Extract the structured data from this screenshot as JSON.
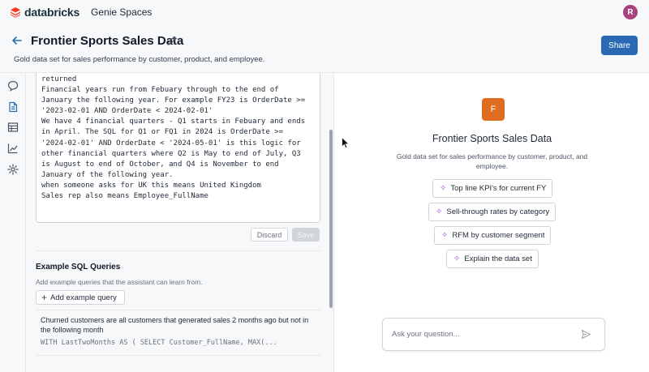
{
  "topbar": {
    "brand": "databricks",
    "product": "Genie Spaces",
    "avatar_initial": "R",
    "avatar_color": "#a5427f"
  },
  "header": {
    "title": "Frontier Sports Sales Data",
    "subtitle": "Gold data set for sales performance by customer, product, and employee.",
    "share_label": "Share",
    "accent_color": "#2a6ab5"
  },
  "rail": {
    "icons": [
      "chat-icon",
      "document-icon",
      "table-icon",
      "chart-icon",
      "gear-icon"
    ],
    "active": "document-icon"
  },
  "instructions": {
    "lines": [
      "returned",
      "Financial years run from Febuary through to the end of",
      "January the following year. For example FY23 is OrderDate >=",
      "'2023-02-01 AND OrderDate < 2024-02-01'",
      "We have 4 financial quarters - Q1 starts in Febuary and ends",
      "in April. The SQL for Q1 or FQ1 in 2024 is OrderDate >=",
      "'2024-02-01' AND OrderDate < '2024-05-01' is this logic for",
      "other financial quarters where Q2 is May to end of July, Q3",
      "is August to end of October, and Q4 is November to end",
      "January of the following year.",
      "when someone asks for UK this means United Kingdom",
      "Sales rep also means Employee_FullName"
    ],
    "discard_label": "Discard",
    "save_label": "Save"
  },
  "example_queries": {
    "title": "Example SQL Queries",
    "description": "Add example queries that the assistant can learn from.",
    "add_label": "Add example query",
    "items": [
      {
        "question": "Churned customers are all customers that generated sales 2 months ago but not in the following month",
        "sql": "WITH LastTwoMonths AS ( SELECT Customer_FullName, MAX(..."
      }
    ]
  },
  "chat": {
    "space_initial": "F",
    "space_color": "#e06c1f",
    "space_title": "Frontier Sports Sales Data",
    "space_description": "Gold data set for sales performance by customer, product, and employee.",
    "suggestions": [
      "Top line KPI's for current FY",
      "Sell-through rates by category",
      "RFM by customer segment",
      "Explain the data set"
    ],
    "ask_placeholder": "Ask your question..."
  }
}
